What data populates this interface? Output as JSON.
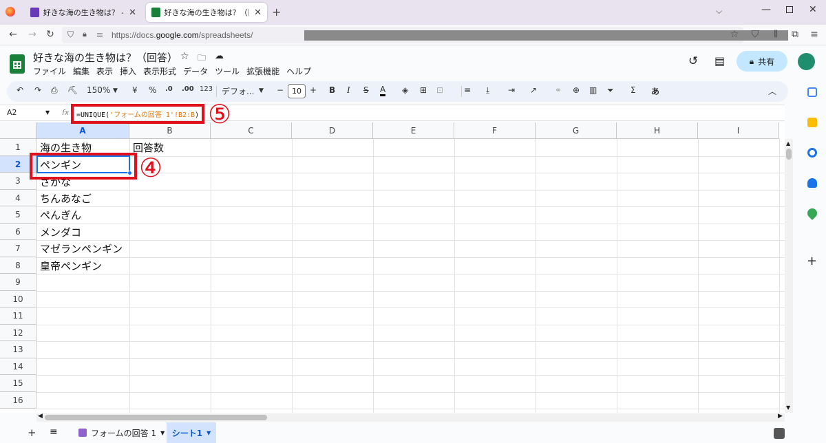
{
  "browser": {
    "tabs": [
      {
        "title": "好きな海の生き物は？ - Google フ"
      },
      {
        "title": "好きな海の生き物は？（回答）- "
      }
    ],
    "url_prefix": "https://docs.",
    "url_domain": "google.com",
    "url_path": "/spreadsheets/"
  },
  "sheets": {
    "doc_title": "好きな海の生き物は？（回答）",
    "menu": [
      "ファイル",
      "編集",
      "表示",
      "挿入",
      "表示形式",
      "データ",
      "ツール",
      "拡張機能",
      "ヘルプ"
    ],
    "share_label": "共有",
    "toolbar": {
      "zoom": "150%",
      "currency": "¥",
      "percent": "%",
      "dec_less": ".0",
      "dec_more": ".00",
      "number_format": "123",
      "font": "デフォ...",
      "font_size": "10",
      "input_mode": "あ"
    },
    "name_box": "A2",
    "formula_prefix": "=UNIQUE(",
    "formula_string": "'フォームの回答 1'!B2:B",
    "formula_suffix": ")",
    "columns": [
      "A",
      "B",
      "C",
      "D",
      "E",
      "F",
      "G",
      "H",
      "I"
    ],
    "rows": [
      "1",
      "2",
      "3",
      "4",
      "5",
      "6",
      "7",
      "8",
      "9",
      "10",
      "11",
      "12",
      "13",
      "14",
      "15",
      "16"
    ],
    "cells": {
      "A1": "海の生き物",
      "B1": "回答数",
      "A2": "ペンギン",
      "A3": "さかな",
      "A4": "ちんあなご",
      "A5": "ぺんぎん",
      "A6": "メンダコ",
      "A7": "マゼランペンギン",
      "A8": "皇帝ペンギン"
    },
    "sheet_tabs": [
      {
        "label": "フォームの回答 1"
      },
      {
        "label": "シート1"
      }
    ]
  },
  "annotations": {
    "label_4": "④",
    "label_5": "⑤"
  },
  "colors": {
    "accent_red": "#e0101c",
    "sheets_green": "#188038",
    "share_bg": "#c2e7ff"
  }
}
